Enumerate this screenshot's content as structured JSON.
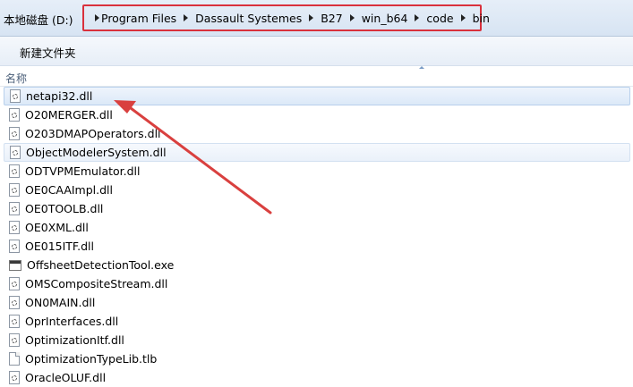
{
  "address": {
    "root": "本地磁盘 (D:)",
    "crumbs": [
      "Program Files",
      "Dassault Systemes",
      "B27",
      "win_b64",
      "code",
      "bin"
    ],
    "highlight_color": "#d9303c"
  },
  "toolbar": {
    "new_folder_label": "新建文件夹"
  },
  "columns": {
    "name_label": "名称"
  },
  "files": [
    {
      "name": "netapi32.dll",
      "icon": "dll-file-icon",
      "state": "selected"
    },
    {
      "name": "O20MERGER.dll",
      "icon": "dll-file-icon",
      "state": ""
    },
    {
      "name": "O203DMAPOperators.dll",
      "icon": "dll-file-icon",
      "state": ""
    },
    {
      "name": "ObjectModelerSystem.dll",
      "icon": "dll-file-icon",
      "state": "hover"
    },
    {
      "name": "ODTVPMEmulator.dll",
      "icon": "dll-file-icon",
      "state": ""
    },
    {
      "name": "OE0CAAImpl.dll",
      "icon": "dll-file-icon",
      "state": ""
    },
    {
      "name": "OE0TOOLB.dll",
      "icon": "dll-file-icon",
      "state": ""
    },
    {
      "name": "OE0XML.dll",
      "icon": "dll-file-icon",
      "state": ""
    },
    {
      "name": "OE015ITF.dll",
      "icon": "dll-file-icon",
      "state": ""
    },
    {
      "name": "OffsheetDetectionTool.exe",
      "icon": "exe-file-icon",
      "state": ""
    },
    {
      "name": "OMSCompositeStream.dll",
      "icon": "dll-file-icon",
      "state": ""
    },
    {
      "name": "ON0MAIN.dll",
      "icon": "dll-file-icon",
      "state": ""
    },
    {
      "name": "OprInterfaces.dll",
      "icon": "dll-file-icon",
      "state": ""
    },
    {
      "name": "OptimizationItf.dll",
      "icon": "dll-file-icon",
      "state": ""
    },
    {
      "name": "OptimizationTypeLib.tlb",
      "icon": "blank-file-icon",
      "state": ""
    },
    {
      "name": "OracleOLUF.dll",
      "icon": "dll-file-icon",
      "state": ""
    }
  ],
  "annotation": {
    "color": "#d9403f"
  }
}
